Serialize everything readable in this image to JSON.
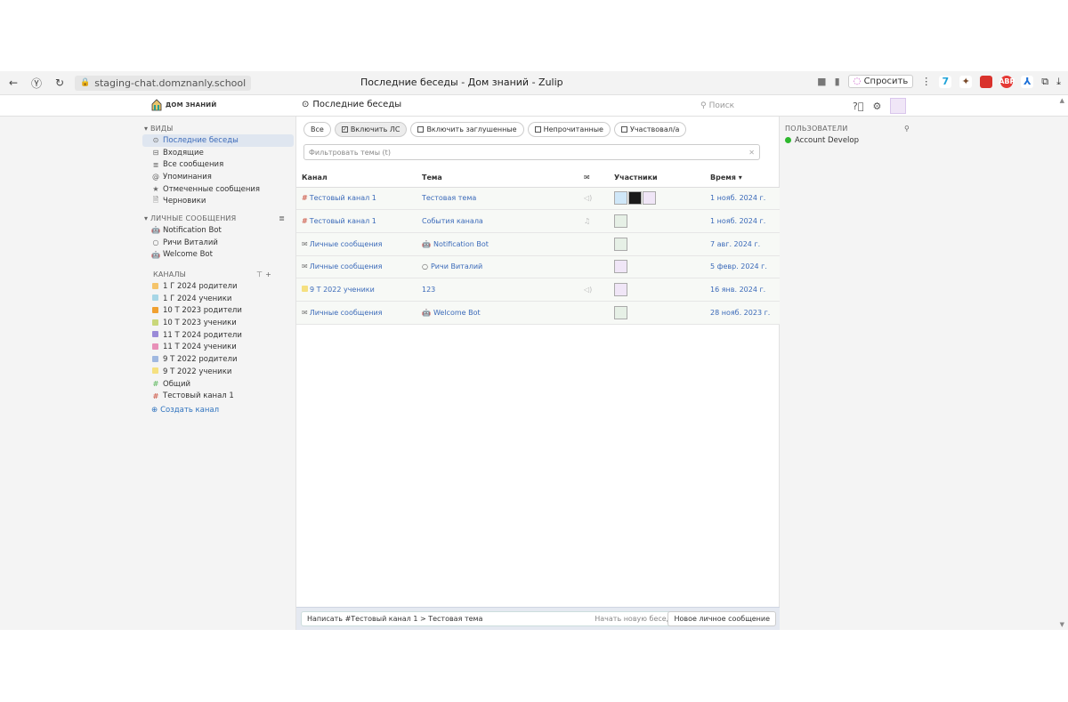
{
  "browser": {
    "url": "staging-chat.domznanly.school",
    "title": "Последние беседы - Дом знаний - Zulip",
    "ask_label": "Спросить"
  },
  "header": {
    "logo_text": "ДОМ ЗНАНИЙ",
    "title": "Последние беседы",
    "search_placeholder": "Поиск"
  },
  "left_sidebar": {
    "views_header": "ВИДЫ",
    "views": [
      {
        "label": "Последние беседы",
        "icon": "clock-icon"
      },
      {
        "label": "Входящие",
        "icon": "inbox-icon"
      },
      {
        "label": "Все сообщения",
        "icon": "list-icon"
      },
      {
        "label": "Упоминания",
        "icon": "at-icon"
      },
      {
        "label": "Отмеченные сообщения",
        "icon": "star-icon"
      },
      {
        "label": "Черновики",
        "icon": "draft-icon"
      }
    ],
    "dm_header": "ЛИЧНЫЕ СООБЩЕНИЯ",
    "dms": [
      {
        "label": "Notification Bot",
        "icon": "bot-icon"
      },
      {
        "label": "Ричи Виталий",
        "icon": "circle-icon"
      },
      {
        "label": "Welcome Bot",
        "icon": "bot-icon"
      }
    ],
    "channels_header": "КАНАЛЫ",
    "channels": [
      {
        "label": "1 Г 2024 родители",
        "color": "#f5c46a",
        "icon": "lock"
      },
      {
        "label": "1 Г 2024 ученики",
        "color": "#a7d6e6",
        "icon": "lock"
      },
      {
        "label": "10 Т 2023 родители",
        "color": "#f0a030",
        "icon": "lock"
      },
      {
        "label": "10 Т 2023 ученики",
        "color": "#c9d77a",
        "icon": "lock"
      },
      {
        "label": "11 Т 2024 родители",
        "color": "#9a8ad8",
        "icon": "lock"
      },
      {
        "label": "11 Т 2024 ученики",
        "color": "#e890b8",
        "icon": "lock"
      },
      {
        "label": "9 Т 2022 родители",
        "color": "#a0b8e0",
        "icon": "lock"
      },
      {
        "label": "9 Т 2022 ученики",
        "color": "#f5e080",
        "icon": "lock"
      },
      {
        "label": "Общий",
        "color": "#76c276",
        "icon": "hash"
      },
      {
        "label": "Тестовый канал 1",
        "color": "#d26b5c",
        "icon": "hash"
      }
    ],
    "create_channel": "Создать канал"
  },
  "filters": {
    "chips": [
      {
        "label": "Все",
        "checkbox": false,
        "checked": false
      },
      {
        "label": "Включить ЛС",
        "checkbox": true,
        "checked": true
      },
      {
        "label": "Включить заглушенные",
        "checkbox": true,
        "checked": false
      },
      {
        "label": "Непрочитанные",
        "checkbox": true,
        "checked": false
      },
      {
        "label": "Участвовал/а",
        "checkbox": true,
        "checked": false
      }
    ],
    "topic_filter_placeholder": "Фильтровать темы (t)"
  },
  "table": {
    "headers": {
      "channel": "Канал",
      "topic": "Тема",
      "participants": "Участники",
      "time": "Время ▾"
    },
    "rows": [
      {
        "channel": "Тестовый канал 1",
        "channel_icon": "hash",
        "channel_color": "#d26b5c",
        "topic": "Тестовая тема",
        "topic_icon": "",
        "bell": "🔇",
        "participants": 3,
        "time": "1 нояб. 2024 г."
      },
      {
        "channel": "Тестовый канал 1",
        "channel_icon": "hash",
        "channel_color": "#d26b5c",
        "topic": "События канала",
        "topic_icon": "",
        "bell": "🔔",
        "participants": 1,
        "time": "1 нояб. 2024 г."
      },
      {
        "channel": "Личные сообщения",
        "channel_icon": "mail",
        "channel_color": "#666",
        "topic": "Notification Bot",
        "topic_icon": "bot",
        "bell": "",
        "participants": 1,
        "time": "7 авг. 2024 г."
      },
      {
        "channel": "Личные сообщения",
        "channel_icon": "mail",
        "channel_color": "#666",
        "topic": "Ричи Виталий",
        "topic_icon": "circle",
        "bell": "",
        "participants": 1,
        "time": "5 февр. 2024 г."
      },
      {
        "channel": "9 Т 2022 ученики",
        "channel_icon": "lock",
        "channel_color": "#f5e080",
        "topic": "123",
        "topic_icon": "",
        "bell": "🔇",
        "participants": 1,
        "time": "16 янв. 2024 г."
      },
      {
        "channel": "Личные сообщения",
        "channel_icon": "mail",
        "channel_color": "#666",
        "topic": "Welcome Bot",
        "topic_icon": "bot",
        "bell": "",
        "participants": 1,
        "time": "28 нояб. 2023 г."
      }
    ]
  },
  "compose": {
    "input_text": "Написать #Тестовый канал 1 > Тестовая тема",
    "new_topic": "Начать новую беседу",
    "new_dm": "Новое личное сообщение"
  },
  "right_sidebar": {
    "users_header": "ПОЛЬЗОВАТЕЛИ",
    "users": [
      {
        "name": "Account Develop",
        "status": "online"
      }
    ]
  }
}
